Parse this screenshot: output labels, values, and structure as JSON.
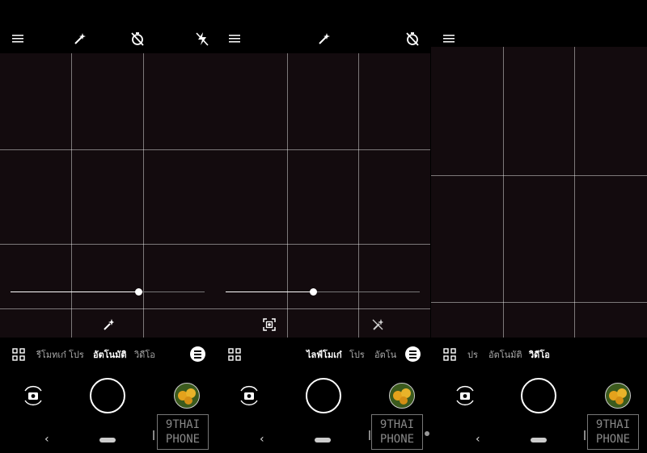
{
  "panels": [
    {
      "modes": [
        "รีโมทเก๋",
        "โปร",
        "อัตโนมัติ",
        "วิดีโอ"
      ],
      "active_mode": "อัตโนมัติ"
    },
    {
      "modes": [
        "ไลฟ์โมเก๋",
        "โปร",
        "อัตโน"
      ],
      "active_mode": "ไลฟ์โมเก๋"
    },
    {
      "modes": [
        "ปร",
        "อัตโนมัติ",
        "วิดีโอ"
      ],
      "active_mode": "วิดีโอ"
    }
  ],
  "zoom_levels": [
    0.66,
    0.45
  ],
  "watermark": {
    "line1": "9THAI",
    "line2": "PHONE"
  },
  "nav": {
    "back": "‹"
  },
  "colors": {
    "viewfinder": "#130b0e",
    "accent": "#ffffff",
    "thumbnail_flower": "#e4a21c"
  },
  "icons": [
    "menu-icon",
    "magic-wand-icon",
    "timer-off-icon",
    "flash-off-icon",
    "grid-icon",
    "filter-icon",
    "switch-camera-icon",
    "focus-frame-icon"
  ]
}
